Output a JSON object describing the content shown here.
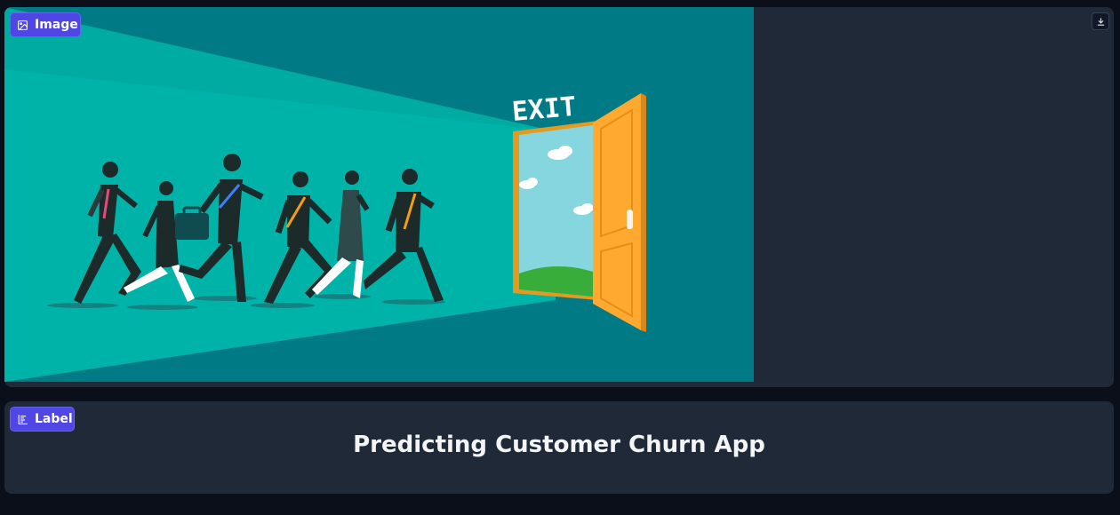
{
  "image_panel": {
    "badge_label": "Image",
    "illustration": {
      "description_icon": "people-running-to-exit-door-illustration",
      "sign_text": "EXIT",
      "background_color": "#007b85",
      "floor_color": "#00b3a9",
      "door_color": "#ffa930"
    },
    "download_icon": "download-icon"
  },
  "label_panel": {
    "badge_label": "Label",
    "value": "Predicting Customer Churn App"
  },
  "colors": {
    "page_background": "#0b0f19",
    "panel_background": "#1f2937",
    "badge_background": "#4f46e5",
    "text": "#f3f4f6"
  }
}
